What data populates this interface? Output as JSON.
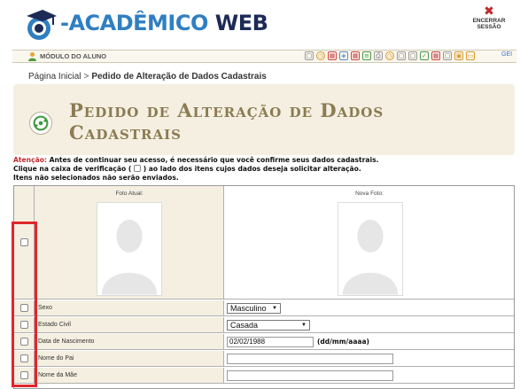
{
  "header": {
    "logo_prefix": "-ACADÊMICO",
    "logo_suffix": "WEB",
    "logout_line1": "ENCERRAR",
    "logout_line2": "SESSÃO"
  },
  "modbar": {
    "module_label": "MÓDULO DO ALUNO",
    "gei_label": "GEI"
  },
  "breadcrumb": {
    "home": "Página Inicial",
    "separator": ">",
    "current": "Pedido de Alteração de Dados Cadastrais"
  },
  "page": {
    "title": "Pedido de Alteração de Dados Cadastrais"
  },
  "notice": {
    "warn_label": "Atenção:",
    "line1": "Antes de continuar seu acesso, é necessário que você confirme seus dados cadastrais.",
    "line2_a": "Clique na caixa de verificação (",
    "line2_b": ") ao lado dos itens cujos dados deseja solicitar alteração.",
    "line3": "Itens não selecionados não serão enviados."
  },
  "table": {
    "photo_current_label": "Foto Atual:",
    "photo_new_label": "Nova Foto:",
    "rows": [
      {
        "label": "Sexo",
        "value": "Masculino"
      },
      {
        "label": "Estado Civil",
        "value": "Casada"
      },
      {
        "label": "Data de Nascimento",
        "value": "02/02/1988",
        "hint": "(dd/mm/aaaa)"
      },
      {
        "label": "Nome do Pai",
        "value": ""
      },
      {
        "label": "Nome da Mãe",
        "value": ""
      }
    ]
  },
  "colors": {
    "accent_blue": "#2f7fc1",
    "title_brown": "#8c7b52",
    "panel_beige": "#f4efe1",
    "highlight_red": "#e0262b"
  }
}
